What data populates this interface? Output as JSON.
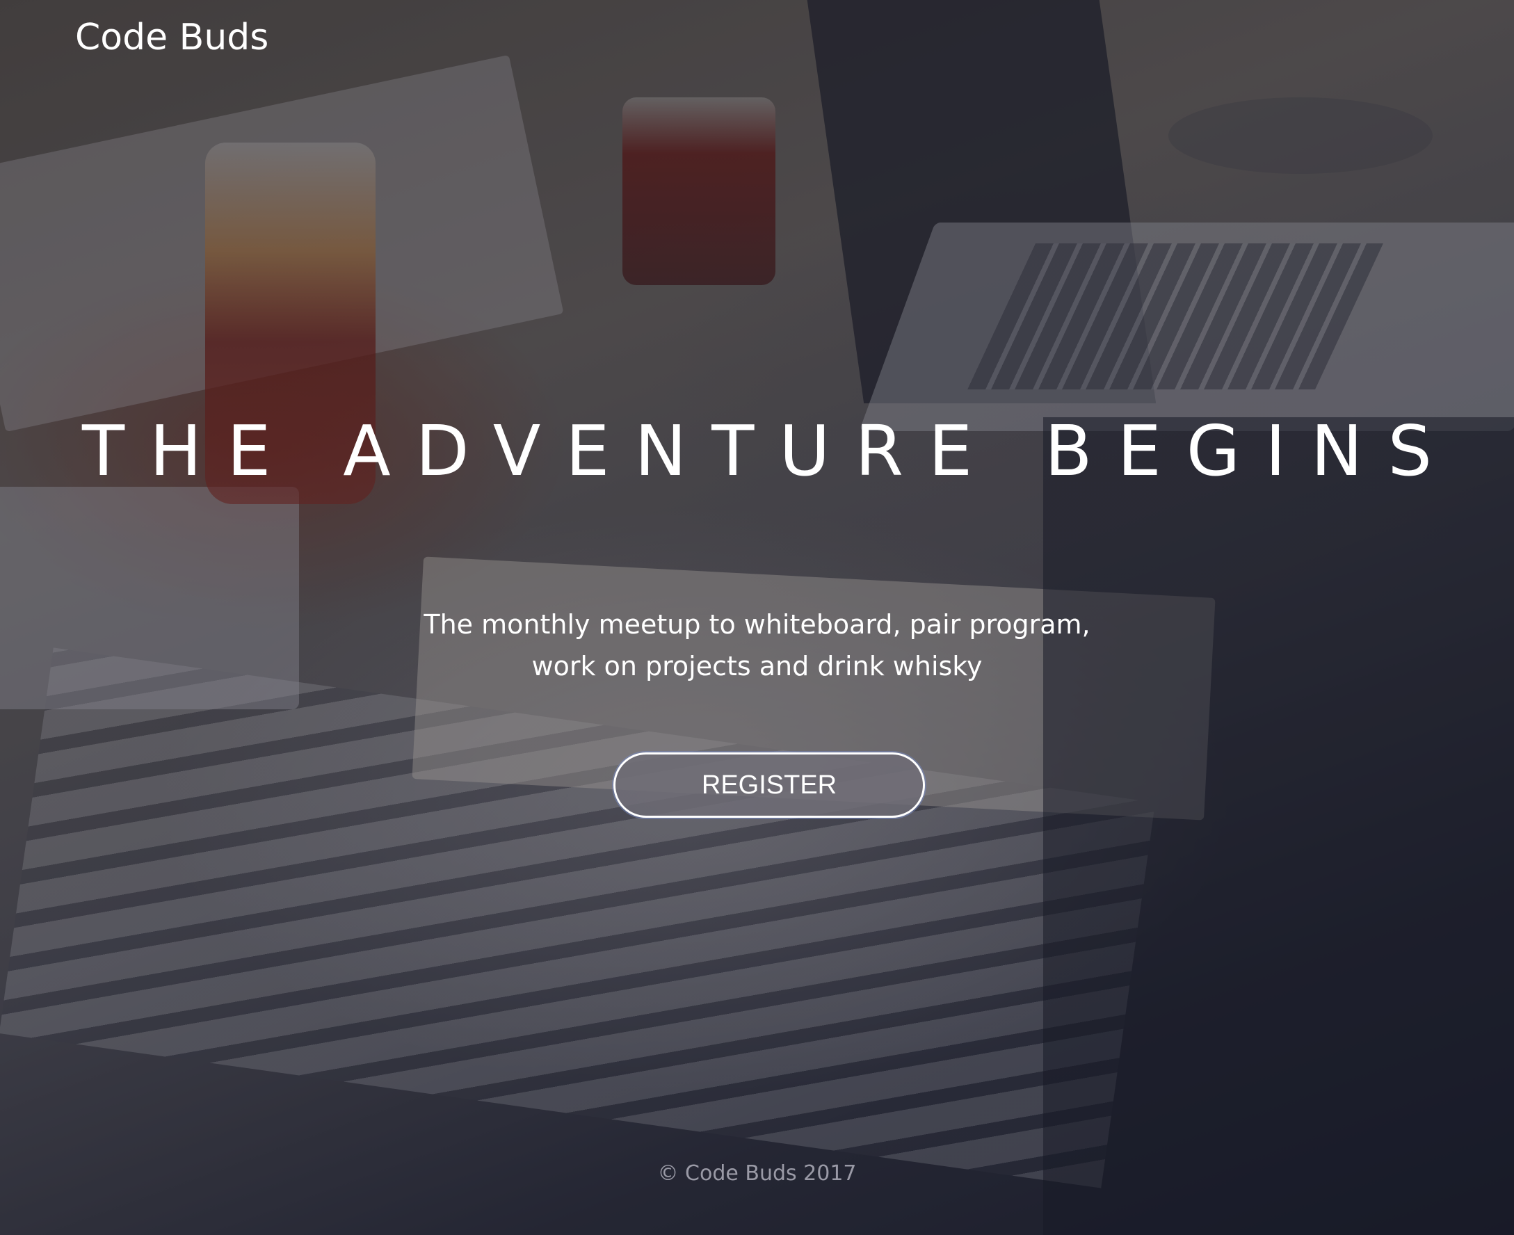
{
  "header": {
    "brand": "Code Buds"
  },
  "hero": {
    "headline": "THE ADVENTURE BEGINS",
    "tagline_line1": "The monthly meetup to whiteboard, pair program,",
    "tagline_line2": "work on projects and drink whisky",
    "register_label": "REGISTER"
  },
  "footer": {
    "copyright": "© Code Buds 2017"
  },
  "colors": {
    "text": "#ffffff",
    "footer_text": "#9a9aa6",
    "button_bg": "#6e6c76"
  }
}
